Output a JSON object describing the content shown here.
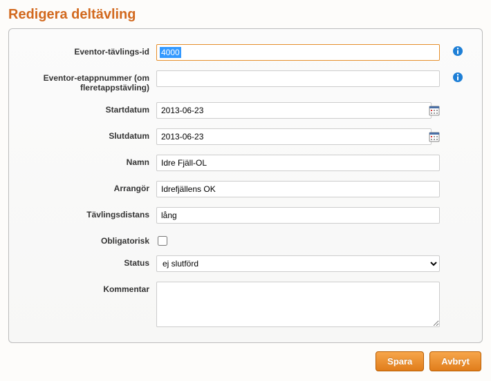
{
  "title": "Redigera deltävling",
  "form": {
    "eventor_id": {
      "label": "Eventor-tävlings-id",
      "value": "4000"
    },
    "stage_no": {
      "label": "Eventor-etappnummer (om fleretappstävling)",
      "value": ""
    },
    "start_date": {
      "label": "Startdatum",
      "value": "2013-06-23"
    },
    "end_date": {
      "label": "Slutdatum",
      "value": "2013-06-23"
    },
    "name": {
      "label": "Namn",
      "value": "Idre Fjäll-OL"
    },
    "organiser": {
      "label": "Arrangör",
      "value": "Idrefjällens OK"
    },
    "distance": {
      "label": "Tävlingsdistans",
      "value": "lång"
    },
    "mandatory": {
      "label": "Obligatorisk",
      "checked": false
    },
    "status": {
      "label": "Status",
      "value": "ej slutförd"
    },
    "comment": {
      "label": "Kommentar",
      "value": ""
    }
  },
  "buttons": {
    "save": "Spara",
    "cancel": "Avbryt"
  }
}
